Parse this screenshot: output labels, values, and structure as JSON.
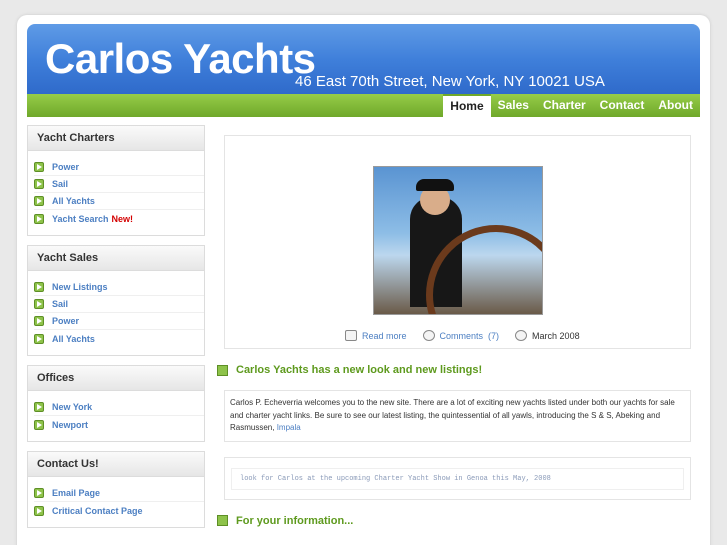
{
  "header": {
    "title": "Carlos Yachts",
    "address": "46 East 70th Street, New York, NY  10021  USA"
  },
  "nav": [
    "Home",
    "Sales",
    "Charter",
    "Contact",
    "About"
  ],
  "sidebar": {
    "charters": {
      "title": "Yacht Charters",
      "items": [
        "Power",
        "Sail",
        "All Yachts",
        "Yacht Search"
      ],
      "new_tag": "New!"
    },
    "sales": {
      "title": "Yacht Sales",
      "items": [
        "New Listings",
        "Sail",
        "Power",
        "All Yachts"
      ]
    },
    "offices": {
      "title": "Offices",
      "items": [
        "New York",
        "Newport"
      ]
    },
    "contact": {
      "title": "Contact Us!",
      "items": [
        "Email Page",
        "Critical Contact Page"
      ]
    }
  },
  "featured": {
    "read_more": "Read more",
    "comments": "Comments",
    "comments_count": "(7)",
    "date": "March 2008"
  },
  "post": {
    "heading": "Carlos Yachts has a new look and new listings!",
    "body": "Carlos P. Echeverria welcomes you to the new site.  There are a lot of exciting new yachts listed under both our yachts for sale and charter yacht links.  Be sure to see our latest listing, the quintessential of all yawls, introducing the S & S, Abeking and Rasmussen, ",
    "link": "Impala"
  },
  "notice": "look for Carlos at the upcoming Charter Yacht Show in Genoa this May, 2008",
  "info_heading": "For your information..."
}
